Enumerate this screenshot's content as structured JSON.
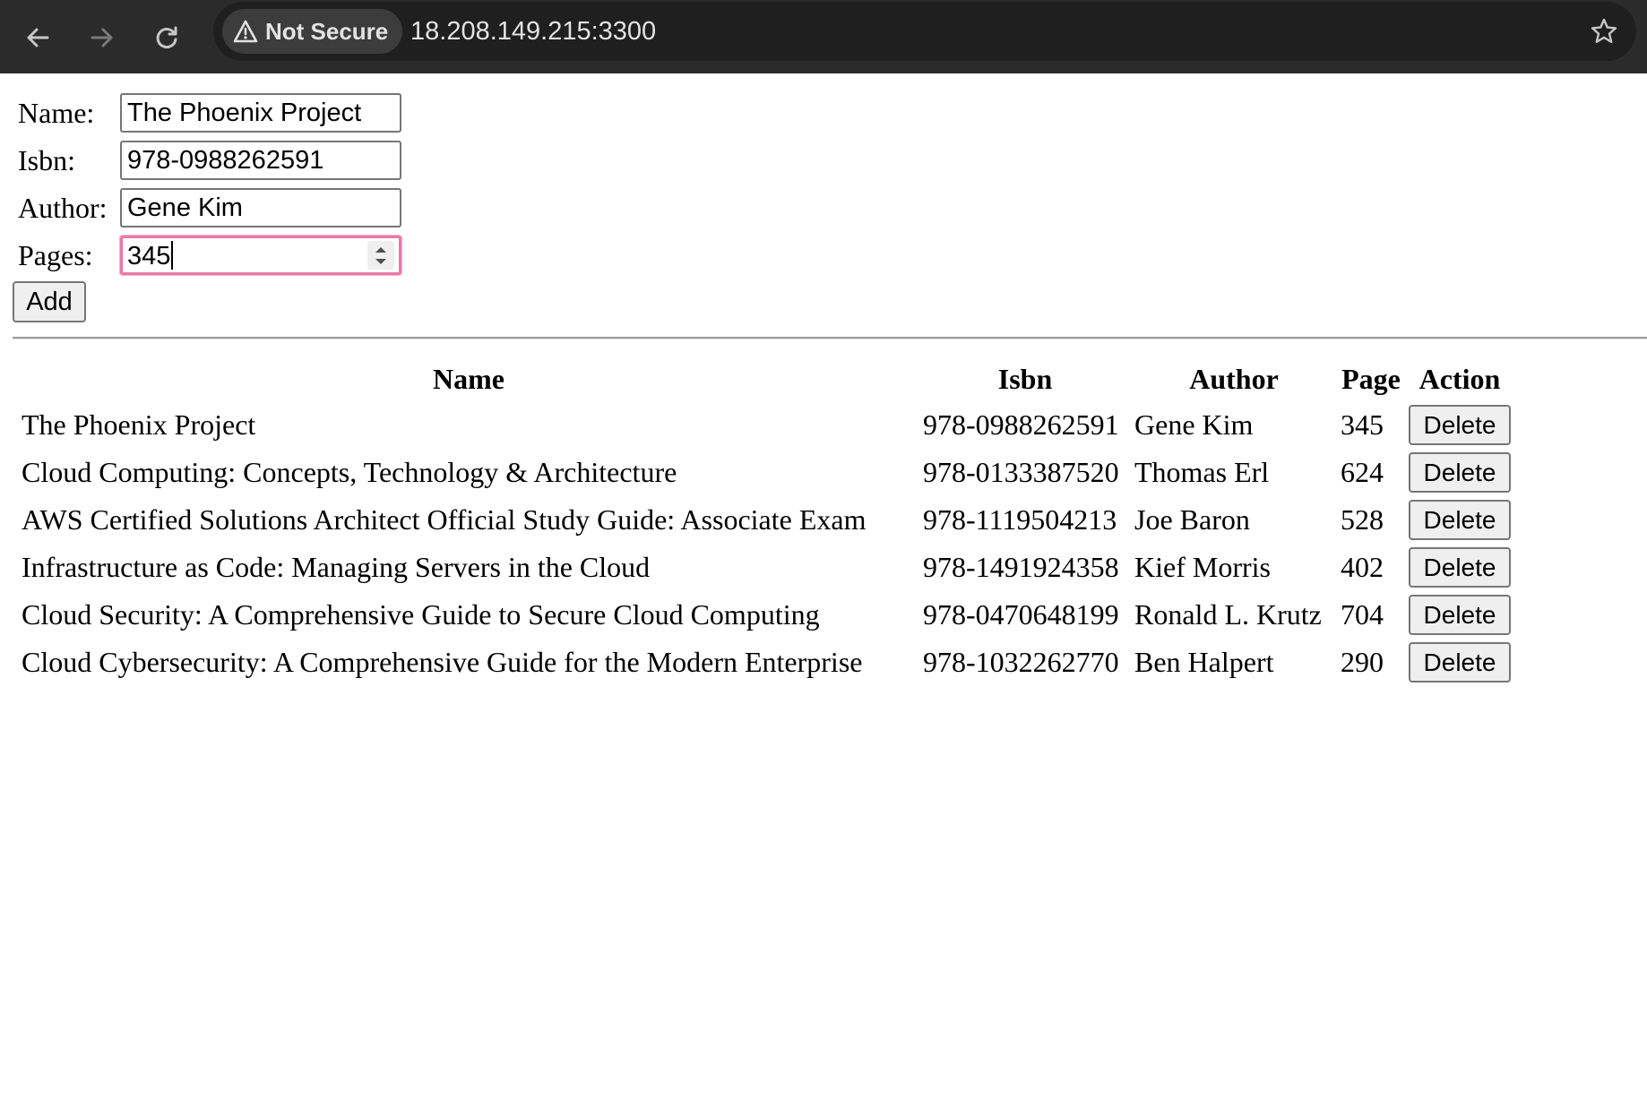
{
  "browser": {
    "security_label": "Not Secure",
    "url": "18.208.149.215:3300",
    "icons": {
      "back": "arrow-left-icon",
      "forward": "arrow-right-icon",
      "reload": "reload-icon",
      "security": "warning-triangle-icon",
      "bookmark": "star-icon"
    },
    "colors": {
      "chrome_bg": "#2b2b2b",
      "omnibox_bg": "#1f1f1f",
      "chip_bg": "#3c3c3c",
      "text": "#e3e3e3"
    }
  },
  "form": {
    "name_label": "Name:",
    "name_value": "The Phoenix Project",
    "isbn_label": "Isbn:",
    "isbn_value": "978-0988262591",
    "author_label": "Author:",
    "author_value": "Gene Kim",
    "pages_label": "Pages:",
    "pages_value": "345",
    "add_label": "Add",
    "focus_color": "#e87aa8"
  },
  "table": {
    "headers": {
      "name": "Name",
      "isbn": "Isbn",
      "author": "Author",
      "page": "Page",
      "action": "Action"
    },
    "rows": [
      {
        "name": "The Phoenix Project",
        "isbn": "978-0988262591",
        "author": "Gene Kim",
        "page": "345",
        "action": "Delete"
      },
      {
        "name": "Cloud Computing: Concepts, Technology & Architecture",
        "isbn": "978-0133387520",
        "author": "Thomas Erl",
        "page": "624",
        "action": "Delete"
      },
      {
        "name": "AWS Certified Solutions Architect Official Study Guide: Associate Exam",
        "isbn": "978-1119504213",
        "author": "Joe Baron",
        "page": "528",
        "action": "Delete"
      },
      {
        "name": "Infrastructure as Code: Managing Servers in the Cloud",
        "isbn": "978-1491924358",
        "author": "Kief Morris",
        "page": "402",
        "action": "Delete"
      },
      {
        "name": "Cloud Security: A Comprehensive Guide to Secure Cloud Computing",
        "isbn": "978-0470648199",
        "author": "Ronald L. Krutz",
        "page": "704",
        "action": "Delete"
      },
      {
        "name": "Cloud Cybersecurity: A Comprehensive Guide for the Modern Enterprise",
        "isbn": "978-1032262770",
        "author": "Ben Halpert",
        "page": "290",
        "action": "Delete"
      }
    ]
  }
}
